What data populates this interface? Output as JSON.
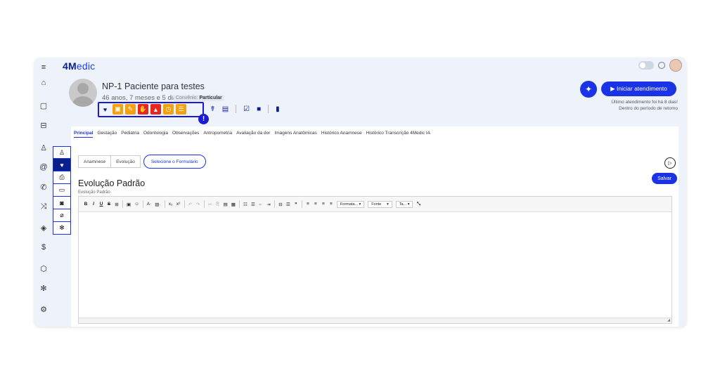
{
  "app": {
    "logo_main": "4M",
    "logo_rest": "edic"
  },
  "rail": [
    {
      "icon": "menu-icon",
      "glyph": "≡"
    },
    {
      "icon": "home-icon",
      "glyph": "⌂"
    },
    {
      "icon": "calendar-icon",
      "glyph": "▢"
    },
    {
      "icon": "sofa-icon",
      "glyph": "⊟"
    },
    {
      "icon": "user-icon",
      "glyph": "♙"
    },
    {
      "icon": "at-icon",
      "glyph": "@"
    },
    {
      "icon": "phone-icon",
      "glyph": "✆"
    },
    {
      "icon": "shuffle-icon",
      "glyph": "⤨"
    },
    {
      "icon": "tag-icon",
      "glyph": "◈"
    },
    {
      "icon": "dollar-icon",
      "glyph": "$"
    },
    {
      "icon": "cube-icon",
      "glyph": "⬡"
    },
    {
      "icon": "sparkle-icon",
      "glyph": "✻"
    },
    {
      "icon": "gear-icon",
      "glyph": "⚙"
    }
  ],
  "patient": {
    "name": "NP-1 Paciente para testes",
    "age": "46 anos, 7 meses e 5 dias",
    "convenio_label": "Convênio:",
    "convenio_value": "Particular"
  },
  "tags": [
    {
      "icon": "heartbeat-icon",
      "glyph": "♥",
      "color": "#eef3fb",
      "fg": "#0a1f8f"
    },
    {
      "icon": "calendar-tag-icon",
      "glyph": "▣",
      "color": "#f5a20c",
      "fg": "#ffffff"
    },
    {
      "icon": "pill-icon",
      "glyph": "✎",
      "color": "#f5a20c",
      "fg": "#ffffff"
    },
    {
      "icon": "hand-icon",
      "glyph": "✋",
      "color": "#e8261d",
      "fg": "#ffffff"
    },
    {
      "icon": "warning-icon",
      "glyph": "▲",
      "color": "#e8261d",
      "fg": "#ffffff"
    },
    {
      "icon": "clock-icon",
      "glyph": "◷",
      "color": "#f5a20c",
      "fg": "#ffffff"
    },
    {
      "icon": "list-icon",
      "glyph": "☰",
      "color": "#f5a20c",
      "fg": "#ffffff"
    }
  ],
  "alert_glyph": "!",
  "actions": [
    {
      "icon": "stethoscope-icon",
      "glyph": "☤"
    },
    {
      "icon": "document-icon",
      "glyph": "▤"
    },
    {
      "icon": "calendar-check-icon",
      "glyph": "☑"
    },
    {
      "icon": "video-icon",
      "glyph": "■"
    },
    {
      "icon": "book-icon",
      "glyph": "▮"
    }
  ],
  "start": {
    "star_glyph": "✦",
    "label": "▶ Iniciar atendimento",
    "last_line1": "Último atendimento foi há 8 dias!",
    "last_line2": "Dentro do período de retorno"
  },
  "tabs": [
    "Principal",
    "Gestação",
    "Pediatria",
    "Odontologia",
    "Observações",
    "Antropometria",
    "Avaliação da dor",
    "Imagens Anatômicas",
    "Histórico Anamnese",
    "Histórico Transcrição 4Medic IA"
  ],
  "side_tabs": [
    {
      "icon": "person-icon",
      "glyph": "♙"
    },
    {
      "icon": "heart-monitor-icon",
      "glyph": "♥"
    },
    {
      "icon": "printer-icon",
      "glyph": "⎙"
    },
    {
      "icon": "folder-icon",
      "glyph": "▭"
    },
    {
      "icon": "camera-icon",
      "glyph": "◙"
    },
    {
      "icon": "clip-icon",
      "glyph": "⌀"
    },
    {
      "icon": "sparkle-side-icon",
      "glyph": "✻"
    }
  ],
  "form": {
    "seg_anamnese": "Anamnese",
    "seg_evolucao": "Evolução",
    "select_label": "Selecione o Formulário",
    "save_label": "Salvar",
    "title": "Evolução Padrão",
    "subtitle": "Evolução Padrão"
  },
  "toolbar": {
    "bold": "B",
    "italic": "I",
    "underline": "U",
    "strike": "S",
    "table": "⊞",
    "image": "▣",
    "emoji": "☺",
    "font_color": "A·",
    "bg_color": "▨·",
    "subscript": "x₂",
    "superscript": "x²",
    "undo": "↶",
    "redo": "↷",
    "cut": "✂",
    "copy": "⎘",
    "paste": "▤",
    "paste_text": "▦",
    "bullets": "☷",
    "numbers": "☰",
    "outdent": "⇤",
    "indent": "⇥",
    "table2": "⊟",
    "hr": "☰",
    "quote": "❞",
    "align_left": "≡",
    "align_center": "≡",
    "align_right": "≡",
    "justify": "≡",
    "format": "Formata...",
    "font": "Fonte",
    "size": "Ta...",
    "expand": "⤡",
    "resize": "◢"
  }
}
